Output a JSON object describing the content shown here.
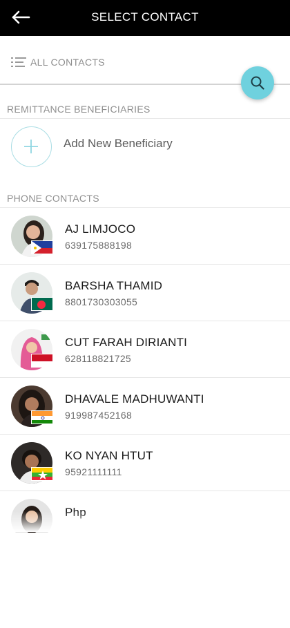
{
  "topbar": {
    "title": "SELECT CONTACT",
    "back_icon": "arrow-left-icon"
  },
  "filter": {
    "label": "ALL CONTACTS",
    "icon": "list-filter-icon"
  },
  "search": {
    "icon": "search-icon",
    "color": "#6fd1de"
  },
  "remittance": {
    "header": "REMITTANCE BENEFICIARIES",
    "add_label": "Add New Beneficiary",
    "add_icon": "plus-icon"
  },
  "phone": {
    "header": "PHONE CONTACTS",
    "contacts": [
      {
        "name": "AJ LIMJOCO",
        "phone": "639175888198",
        "flag": "philippines-flag-icon"
      },
      {
        "name": "BARSHA THAMID",
        "phone": "8801730303055",
        "flag": "bangladesh-flag-icon"
      },
      {
        "name": "CUT FARAH DIRIANTI",
        "phone": "628118821725",
        "flag": "indonesia-flag-icon"
      },
      {
        "name": "DHAVALE MADHUWANTI",
        "phone": "919987452168",
        "flag": "india-flag-icon"
      },
      {
        "name": "KO NYAN HTUT",
        "phone": "95921111111",
        "flag": "myanmar-flag-icon"
      },
      {
        "name": "Php",
        "phone": "",
        "flag": ""
      }
    ]
  }
}
